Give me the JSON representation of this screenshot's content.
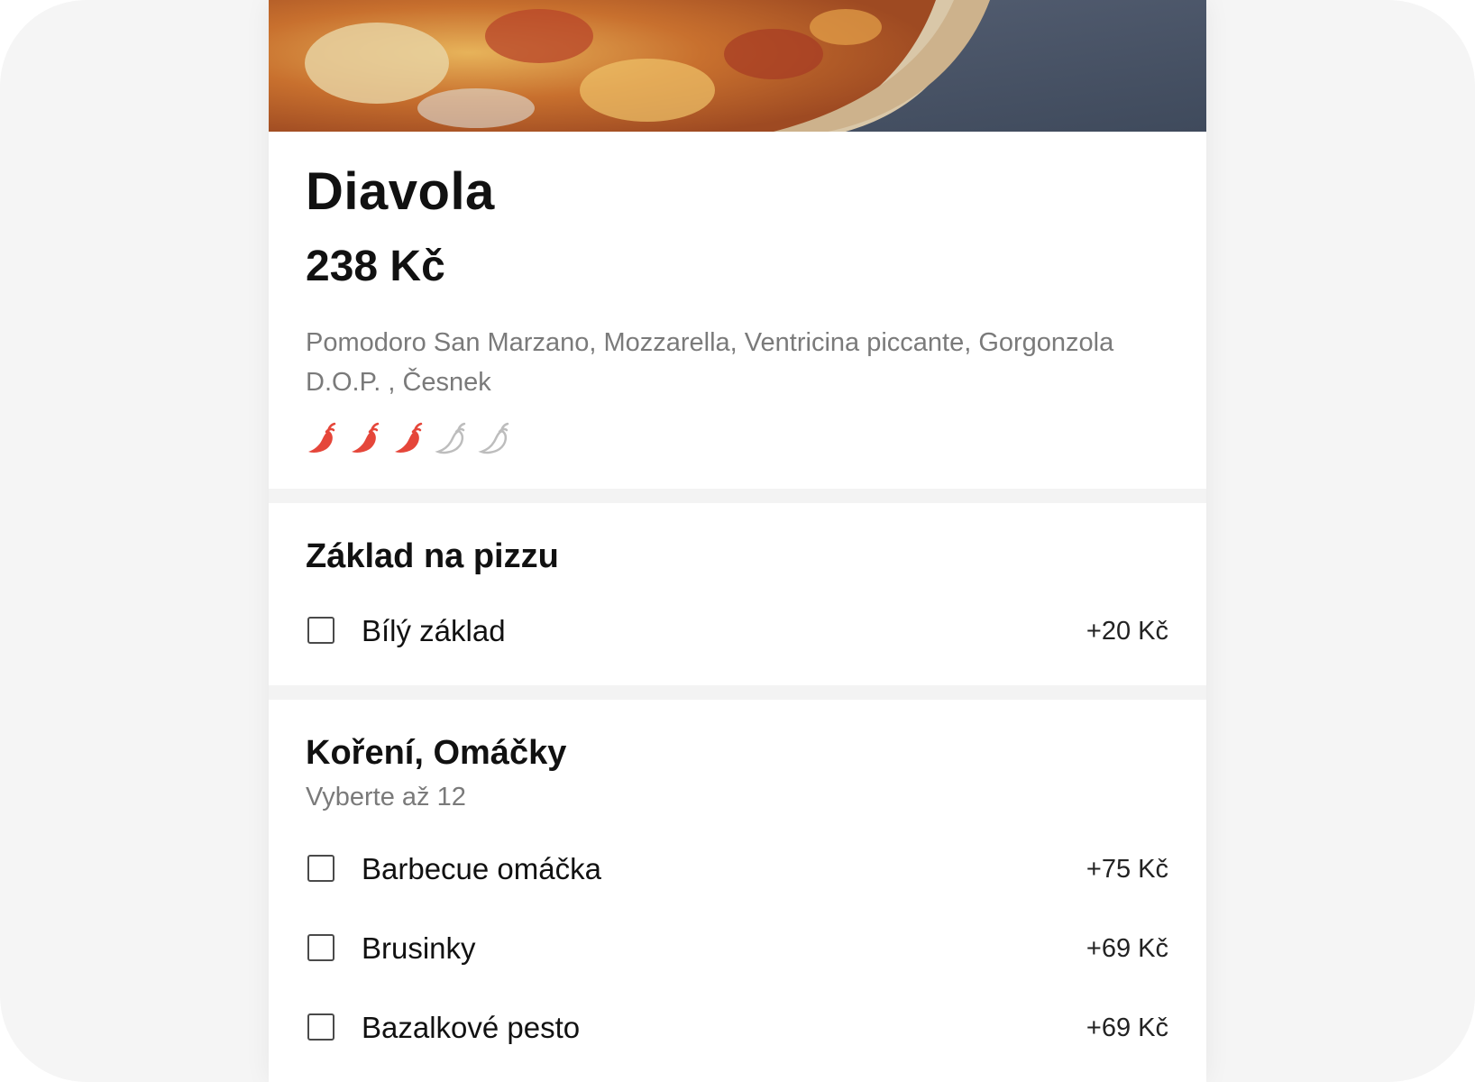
{
  "product": {
    "name": "Diavola",
    "price": "238 Kč",
    "description": "Pomodoro San Marzano, Mozzarella, Ventricina piccante, Gorgonzola D.O.P. , Česnek",
    "spiciness": {
      "level": 3,
      "max": 5,
      "active_color": "#e5463a",
      "inactive_color": "#bdbdbd",
      "icon": "chili-pepper-icon"
    }
  },
  "groups": [
    {
      "title": "Základ na pizzu",
      "options": [
        {
          "label": "Bílý základ",
          "price": "+20 Kč",
          "checked": false
        }
      ]
    },
    {
      "title": "Koření, Omáčky",
      "subtitle": "Vyberte až 12",
      "options": [
        {
          "label": "Barbecue omáčka",
          "price": "+75 Kč",
          "checked": false
        },
        {
          "label": "Brusinky",
          "price": "+69 Kč",
          "checked": false
        },
        {
          "label": "Bazalkové pesto",
          "price": "+69 Kč",
          "checked": false
        }
      ]
    }
  ]
}
